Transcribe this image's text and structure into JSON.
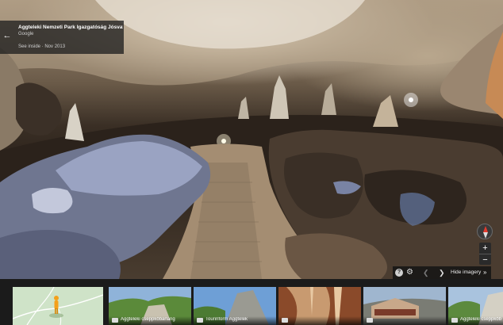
{
  "place": {
    "title": "Aggteleki Nemzeti Park Igazgatóság Jósvafő",
    "provider": "Google",
    "date_label": "See inside · Nov 2013"
  },
  "controls": {
    "back_icon": "arrow-left-icon",
    "zoom_in_label": "+",
    "zoom_out_label": "−",
    "compass_icon": "compass-icon"
  },
  "imagery_bar": {
    "help_label": "?",
    "hide_label": "Hide imagery",
    "icons": [
      "help-icon",
      "gear-icon",
      "chevron-left-icon",
      "chevron-right-icon",
      "double-chevron-down-icon"
    ]
  },
  "filmstrip": {
    "thumbnails": [
      {
        "caption": "Aggteleki cseppkőbarlang",
        "colors": [
          "#8fb3d9",
          "#5b8a3a",
          "#c9c2b0"
        ]
      },
      {
        "caption": "Tourinform Aggtelek",
        "colors": [
          "#6e9fd6",
          "#4c7b33",
          "#9a9a92"
        ]
      },
      {
        "caption": "",
        "colors": [
          "#c89a70",
          "#8a4a2a",
          "#e8c9a3"
        ]
      },
      {
        "caption": "",
        "colors": [
          "#9fb6cf",
          "#7a7c74",
          "#c8a88a"
        ]
      },
      {
        "caption": "Aggteleki cseppkőbarlang",
        "colors": [
          "#a9c3de",
          "#5c8a3e",
          "#d4d0c4"
        ]
      }
    ]
  },
  "colors": {
    "panel_bg": "#202020",
    "filmstrip_bg": "#1b1b1b",
    "map_bg": "#cfe3c8",
    "pegman": "#f4a01b"
  }
}
